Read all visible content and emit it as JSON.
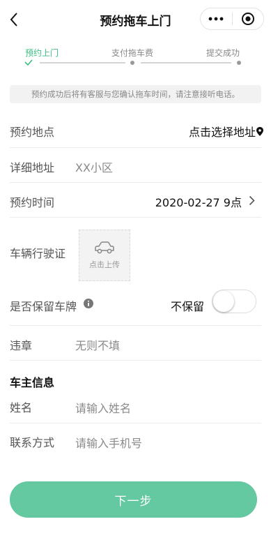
{
  "nav": {
    "title": "预约拖车上门",
    "back_icon": "chevron-left-icon",
    "more_icon": "more-dots-icon",
    "close_icon": "target-circle-icon"
  },
  "steps": {
    "items": [
      {
        "label": "预约上门",
        "active": true
      },
      {
        "label": "支付拖车费",
        "active": false
      },
      {
        "label": "提交成功",
        "active": false
      }
    ],
    "accent_color": "#3bbf7f"
  },
  "notice": "预约成功后将有客服与您确认拖车时间，请注意接听电话。",
  "form": {
    "location": {
      "label": "预约地点",
      "value": "点击选择地址"
    },
    "address": {
      "label": "详细地址",
      "value": "XX小区"
    },
    "time": {
      "label": "预约时间",
      "value": "2020-02-27 9点"
    },
    "license": {
      "label": "车辆行驶证",
      "upload_text": "点击上传"
    },
    "plate": {
      "label": "是否保留车牌",
      "state_text": "不保留",
      "enabled": false
    },
    "violation": {
      "label": "违章",
      "placeholder": "无则不填"
    }
  },
  "owner": {
    "section_title": "车主信息",
    "name": {
      "label": "姓名",
      "placeholder": "请输入姓名"
    },
    "phone": {
      "label": "联系方式",
      "placeholder": "请输入手机号"
    }
  },
  "next_button": "下一步",
  "colors": {
    "button": "#64c8a0",
    "accent": "#3bbf7f"
  }
}
